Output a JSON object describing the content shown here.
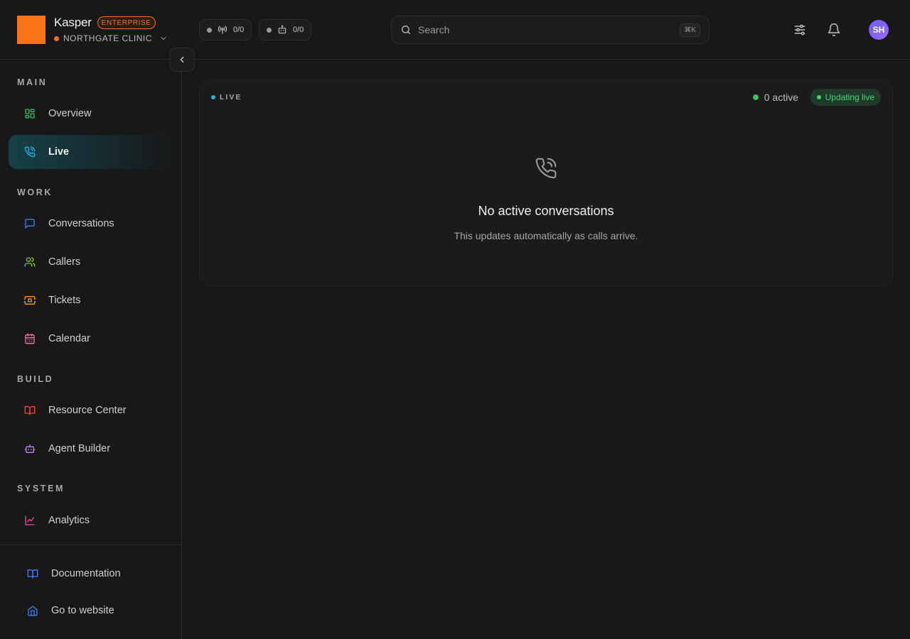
{
  "brand": {
    "name": "Kasper",
    "plan": "ENTERPRISE",
    "logo_color": "#f97316"
  },
  "org": {
    "name": "NORTHGATE CLINIC",
    "status_color": "#f97316"
  },
  "status_pills": [
    {
      "icon": "antenna-icon",
      "count": "0/0"
    },
    {
      "icon": "robot-icon",
      "count": "0/0"
    }
  ],
  "search": {
    "placeholder": "Search",
    "shortcut": "⌘K"
  },
  "user": {
    "initials": "SH"
  },
  "sidebar": {
    "sections": [
      {
        "label": "MAIN"
      },
      {
        "label": "WORK"
      },
      {
        "label": "BUILD"
      },
      {
        "label": "SYSTEM"
      }
    ],
    "items": [
      {
        "label": "Overview",
        "icon": "grid-icon",
        "color": "#22c55e"
      },
      {
        "label": "Live",
        "icon": "phone-icon",
        "color": "#22b8e6",
        "active": true
      },
      {
        "label": "Conversations",
        "icon": "chat-icon",
        "color": "#3b82f6"
      },
      {
        "label": "Callers",
        "icon": "users-icon",
        "color": "#84cc16"
      },
      {
        "label": "Tickets",
        "icon": "ticket-icon",
        "color": "#f59e0b"
      },
      {
        "label": "Calendar",
        "icon": "calendar-icon",
        "color": "#e879a8"
      },
      {
        "label": "Resource Center",
        "icon": "book-icon",
        "color": "#ef4444"
      },
      {
        "label": "Agent Builder",
        "icon": "bot-icon",
        "color": "#c084fc"
      },
      {
        "label": "Analytics",
        "icon": "chart-icon",
        "color": "#ec4899"
      }
    ],
    "footer": [
      {
        "label": "Documentation",
        "icon": "book-open-icon",
        "color": "#3b82f6"
      },
      {
        "label": "Go to website",
        "icon": "home-icon",
        "color": "#3b82f6"
      }
    ]
  },
  "live_panel": {
    "tag": "LIVE",
    "active_count": "0 active",
    "badge": "Updating live",
    "empty_title": "No active conversations",
    "empty_subtitle": "This updates automatically as calls arrive."
  }
}
